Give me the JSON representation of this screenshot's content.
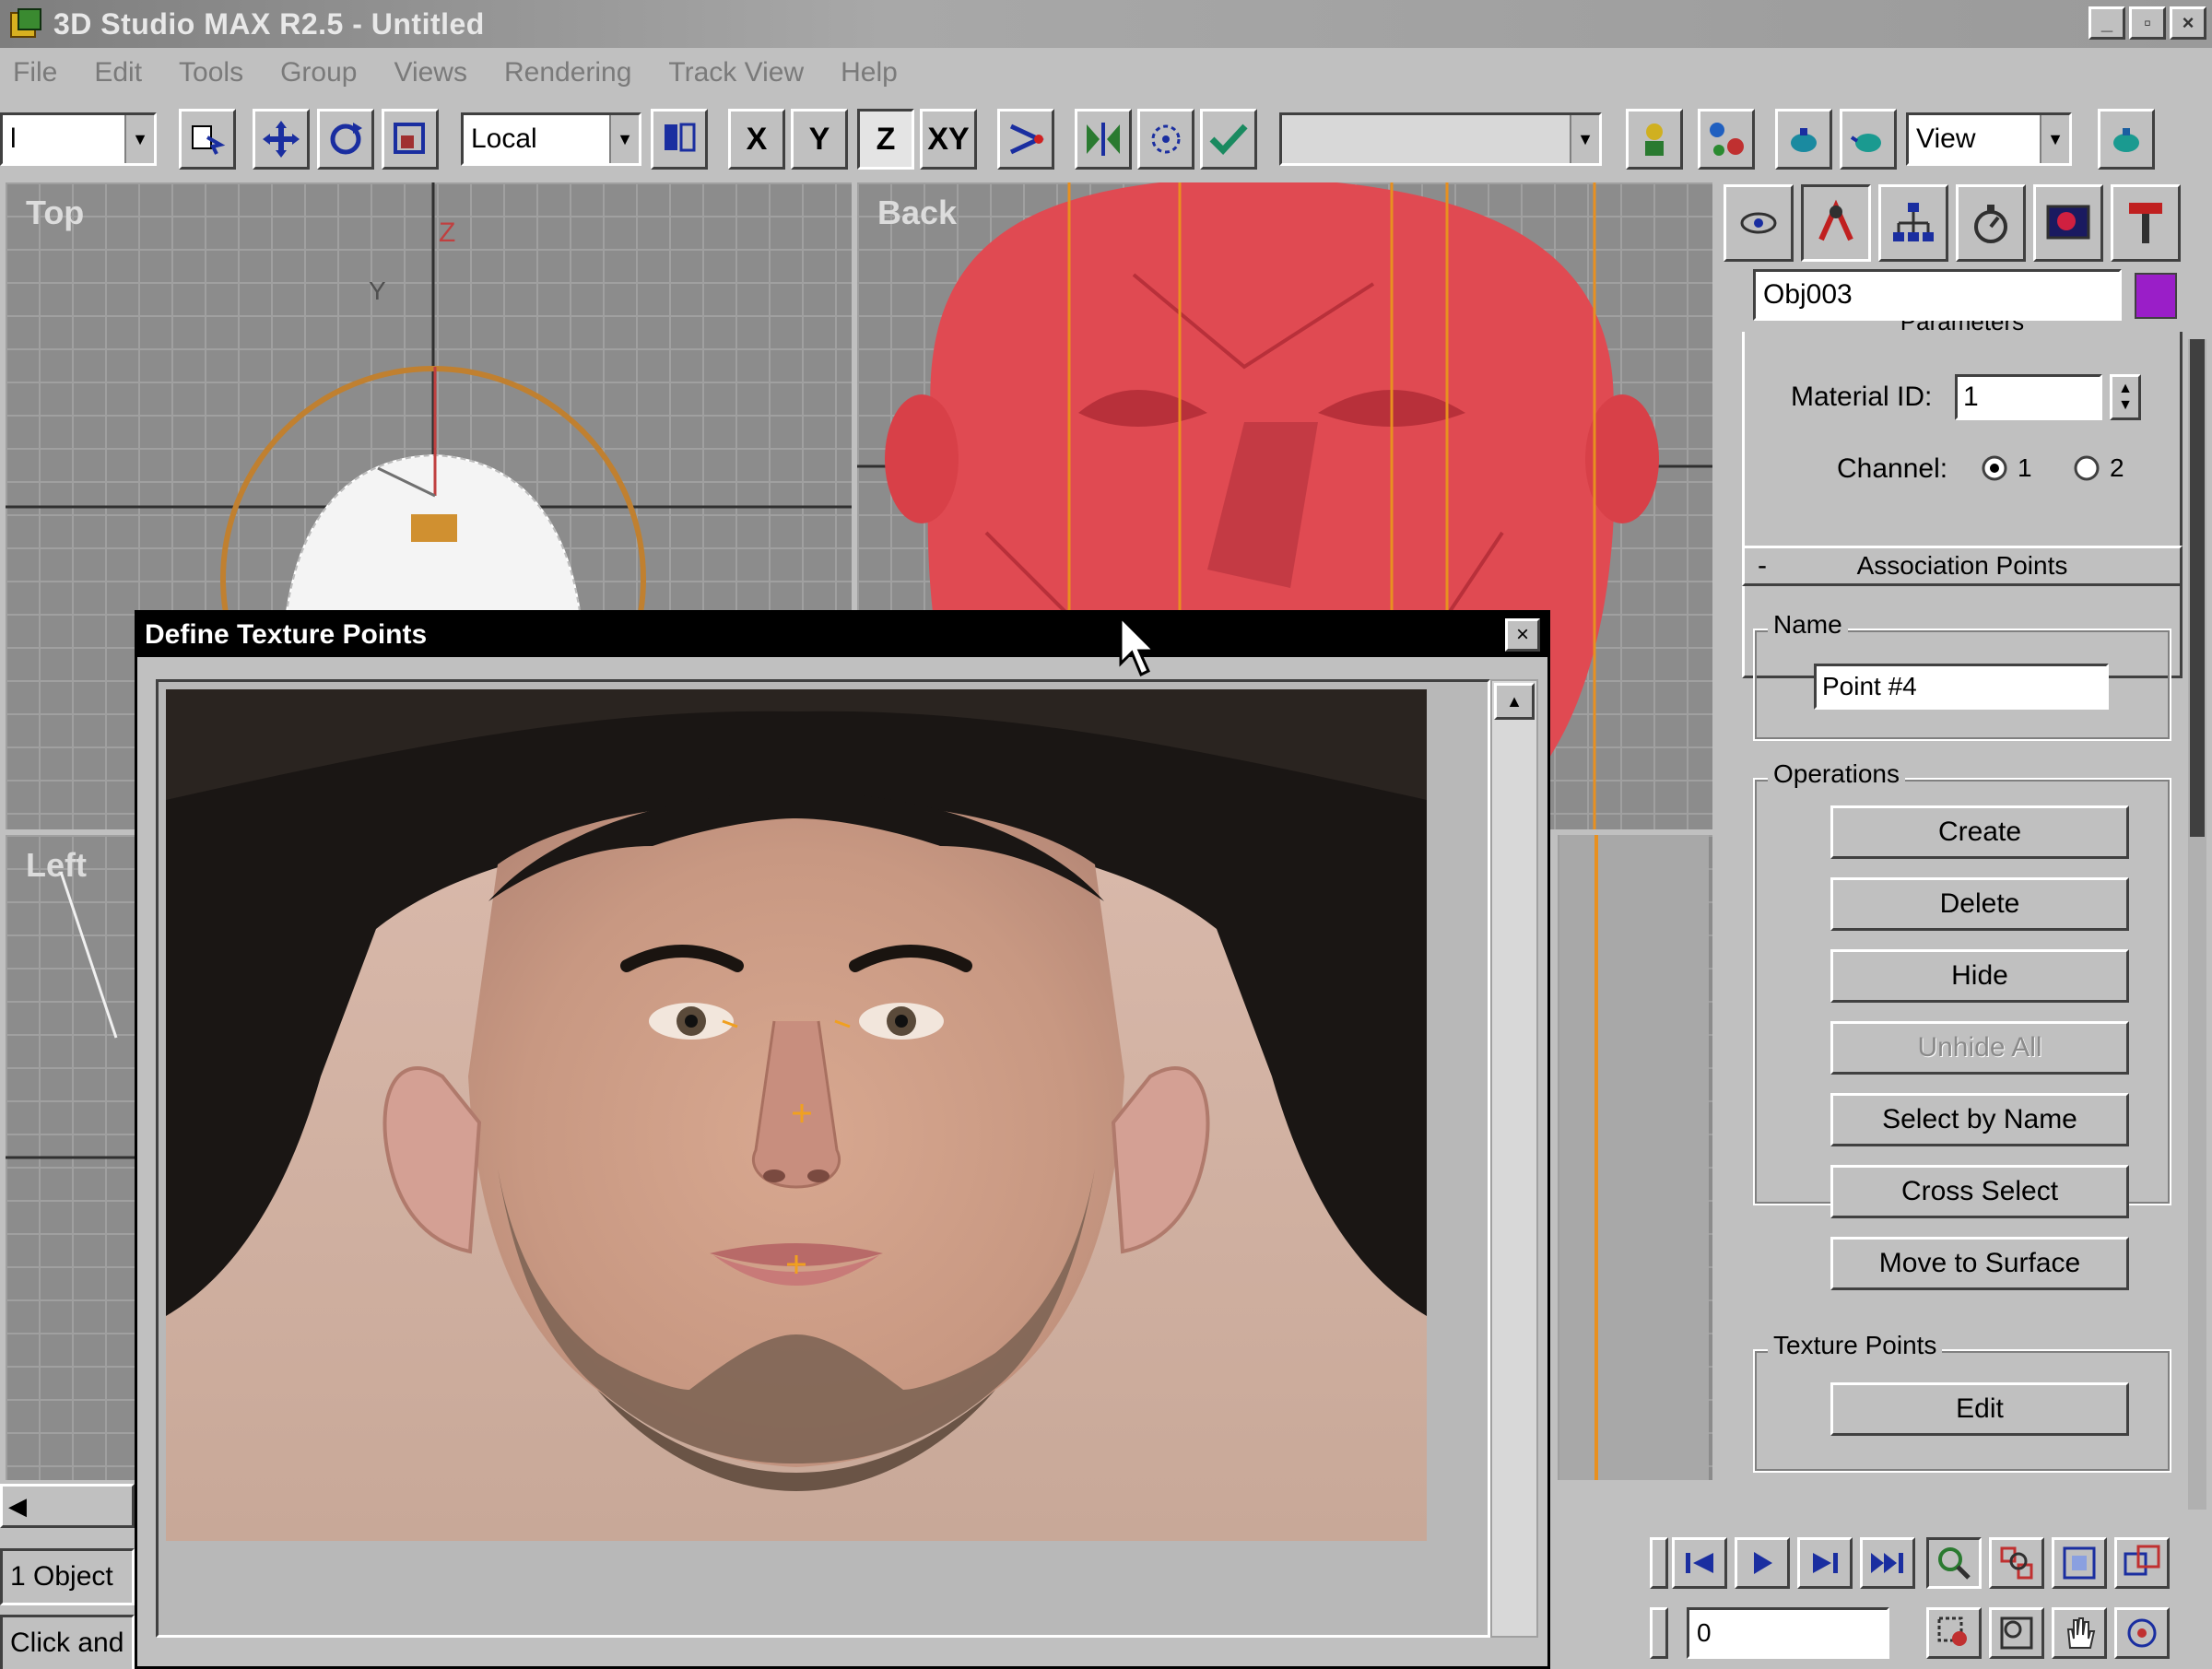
{
  "window": {
    "title": "3D Studio MAX R2.5 - Untitled",
    "controls": [
      "_",
      "▫",
      "×"
    ]
  },
  "menu": [
    "File",
    "Edit",
    "Tools",
    "Group",
    "Views",
    "Rendering",
    "Track View",
    "Help"
  ],
  "toolbar": {
    "selection_filter": "l",
    "coord_system": "Local",
    "axis_x": "X",
    "axis_y": "Y",
    "axis_z": "Z",
    "axis_xy": "XY",
    "named_selection": "",
    "view_dropdown": "View"
  },
  "viewports": {
    "top_label": "Top",
    "back_label": "Back",
    "left_label": "Left",
    "axis_y": "Y",
    "axis_z": "Z"
  },
  "command_panel": {
    "object_name": "Obj003",
    "object_color": "#9a1ec8",
    "parameters_title": "Parameters",
    "material_id_label": "Material ID:",
    "material_id_value": "1",
    "channel_label": "Channel:",
    "channel_1": "1",
    "channel_2": "2",
    "channel_selected": "1",
    "rollout_title": "Association Points",
    "rollout_toggle": "-",
    "name_group_label": "Name",
    "name_value": "Point #4",
    "operations_label": "Operations",
    "buttons": {
      "create": "Create",
      "delete": "Delete",
      "hide": "Hide",
      "unhide_all": "Unhide All",
      "select_by_name": "Select by Name",
      "cross_select": "Cross Select",
      "move_to_surface": "Move to Surface"
    },
    "texture_points_label": "Texture Points",
    "edit_button": "Edit"
  },
  "dialog": {
    "title": "Define Texture Points",
    "close": "×"
  },
  "status": {
    "selection_count": "1 Object",
    "prompt": "Click and"
  },
  "time": {
    "frame_value": "0"
  },
  "colors": {
    "accent_dialog_title": "#000000",
    "head_mesh": "#e04a52",
    "marker": "#f0a020"
  }
}
